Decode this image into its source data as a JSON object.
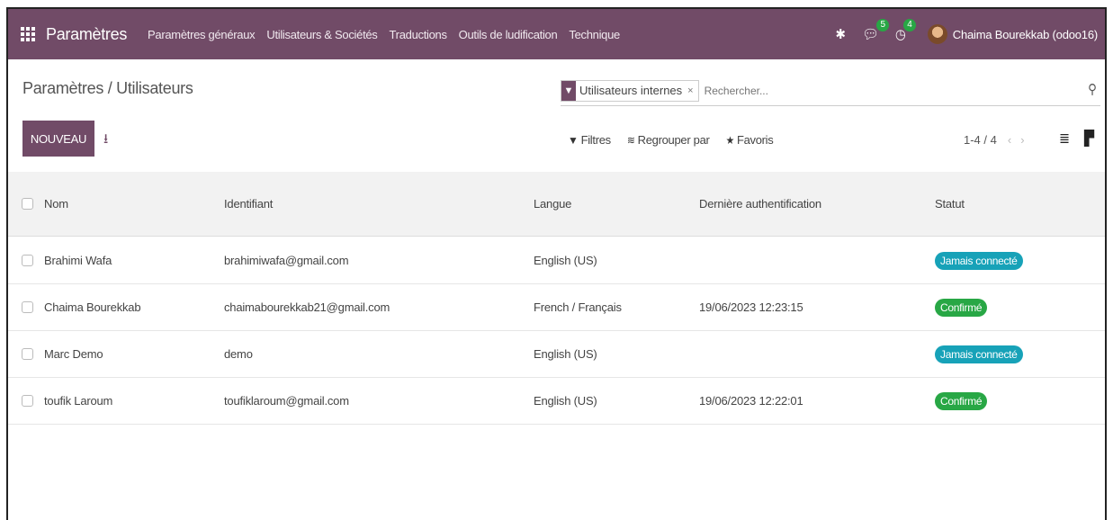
{
  "navbar": {
    "brand": "Paramètres",
    "menu": [
      "Paramètres généraux",
      "Utilisateurs & Sociétés",
      "Traductions",
      "Outils de ludification",
      "Technique"
    ],
    "messages_count": "5",
    "activities_count": "4",
    "user_name": "Chaima Bourekkab (odoo16)",
    "icons": [
      "apps-grid-icon",
      "bug-icon",
      "chat-icon",
      "clock-icon",
      "avatar"
    ],
    "accent_color": "#714B67"
  },
  "control_panel": {
    "breadcrumb": "Paramètres / Utilisateurs",
    "new_button": "NOUVEAU",
    "search": {
      "facet_label": "Utilisateurs internes",
      "facet_close": "×",
      "placeholder": "Rechercher..."
    },
    "filters": "Filtres",
    "group_by": "Regrouper par",
    "favorites": "Favoris",
    "pager": "1-4 / 4"
  },
  "table": {
    "headers": {
      "nom": "Nom",
      "identifiant": "Identifiant",
      "langue": "Langue",
      "derniere_auth": "Dernière authentification",
      "statut": "Statut"
    },
    "rows": [
      {
        "nom": "Brahimi Wafa",
        "identifiant": "brahimiwafa@gmail.com",
        "langue": "English (US)",
        "derniere_auth": "",
        "statut": "Jamais connecté",
        "status_color": "#17a2b8"
      },
      {
        "nom": "Chaima Bourekkab",
        "identifiant": "chaimabourekkab21@gmail.com",
        "langue": "French / Français",
        "derniere_auth": "19/06/2023 12:23:15",
        "statut": "Confirmé",
        "status_color": "#28a745"
      },
      {
        "nom": "Marc Demo",
        "identifiant": "demo",
        "langue": "English (US)",
        "derniere_auth": "",
        "statut": "Jamais connecté",
        "status_color": "#17a2b8"
      },
      {
        "nom": "toufik Laroum",
        "identifiant": "toufiklaroum@gmail.com",
        "langue": "English (US)",
        "derniere_auth": "19/06/2023 12:22:01",
        "statut": "Confirmé",
        "status_color": "#28a745"
      }
    ]
  }
}
